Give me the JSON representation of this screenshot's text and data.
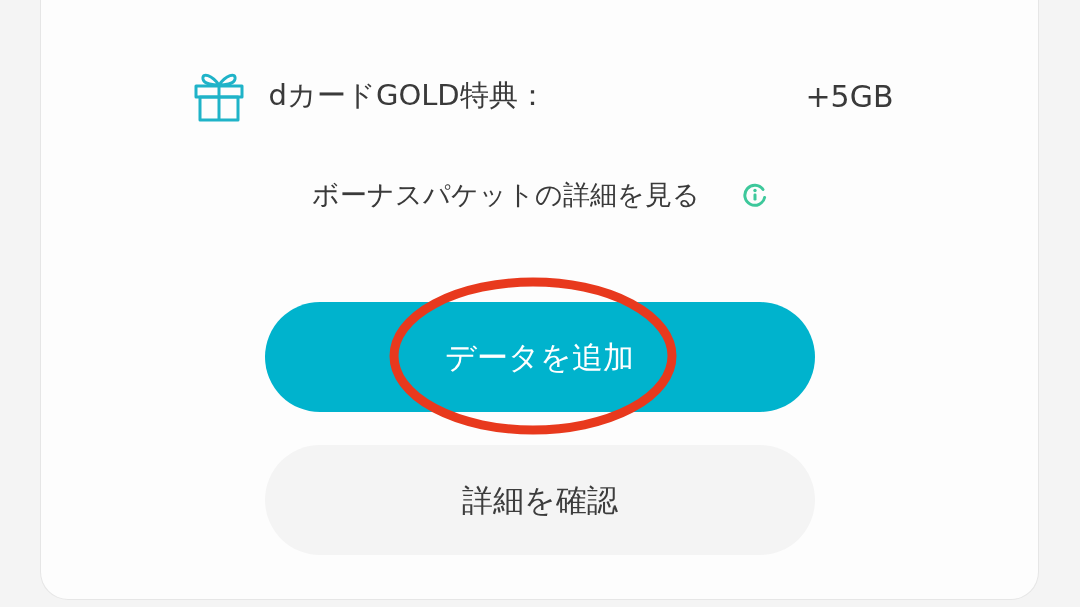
{
  "benefit": {
    "label": "dカードGOLD特典：",
    "value": "+5GB"
  },
  "details_link": {
    "label": "ボーナスパケットの詳細を見る"
  },
  "buttons": [
    {
      "label": "データを追加",
      "kind": "primary",
      "highlighted": true
    },
    {
      "label": "詳細を確認",
      "kind": "secondary",
      "highlighted": false
    }
  ]
}
